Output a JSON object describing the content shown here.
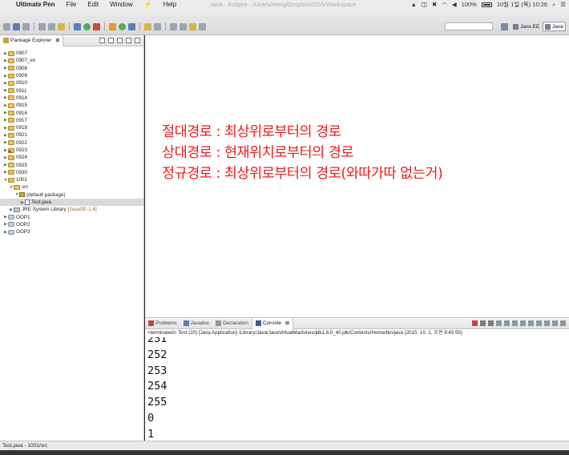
{
  "menubar": {
    "app_name": "Ultimate Pen",
    "items": [
      "File",
      "Edit",
      "Window",
      "Help"
    ],
    "lightning_icon": "⚡",
    "window_title": "Java - Eclipse - /Users/Hong/Dropbox/SDS/Workspace",
    "battery": "100%",
    "datetime": "10월 1일 (목)  10:26"
  },
  "perspectives": {
    "java_ee": "Java EE",
    "java": "Java"
  },
  "package_explorer": {
    "tab_label": "Package Explorer",
    "close": "⊠",
    "projects": [
      {
        "label": "0907",
        "expanded": false
      },
      {
        "label": "0907_ex",
        "expanded": false
      },
      {
        "label": "0908",
        "expanded": false
      },
      {
        "label": "0909",
        "expanded": false
      },
      {
        "label": "0910",
        "expanded": false
      },
      {
        "label": "0911",
        "expanded": false
      },
      {
        "label": "0914",
        "expanded": false
      },
      {
        "label": "0915",
        "expanded": false
      },
      {
        "label": "0916",
        "expanded": false
      },
      {
        "label": "0917",
        "expanded": false
      },
      {
        "label": "0918",
        "expanded": false
      },
      {
        "label": "0921",
        "expanded": false
      },
      {
        "label": "0922",
        "expanded": false
      },
      {
        "label": "0923",
        "expanded": false,
        "error": true
      },
      {
        "label": "0924",
        "expanded": false
      },
      {
        "label": "0925",
        "expanded": false
      },
      {
        "label": "0930",
        "expanded": false
      },
      {
        "label": "1001",
        "expanded": true
      }
    ],
    "src_folder": "src",
    "default_package": "(default package)",
    "file": "Test.java",
    "jre_library": "JRE System Library",
    "jre_version": "[JavaSE-1.8]",
    "other_projects": [
      "OOP1",
      "OOP2",
      "OOP3"
    ]
  },
  "editor": {
    "notes": [
      "절대경로 : 최상위로부터의 경로",
      "상대경로 : 현재위치로부터의 경로",
      "정규경로 : 최상위로부터의 경로(와따가따 없는거)"
    ]
  },
  "bottom_panel": {
    "tabs": [
      "Problems",
      "Javadoc",
      "Declaration",
      "Console"
    ],
    "active_tab": "Console",
    "console_header": "<terminated> Test (20) [Java Application] /Library/Java/JavaVirtualMachines/jdk1.8.0_40.jdk/Contents/Home/bin/java (2015. 10. 1. 오전 9:45:55)",
    "output_lines": [
      "251",
      "252",
      "253",
      "254",
      "255",
      "0",
      "1"
    ]
  },
  "statusbar": {
    "text": "Test.java - 1001/src"
  }
}
